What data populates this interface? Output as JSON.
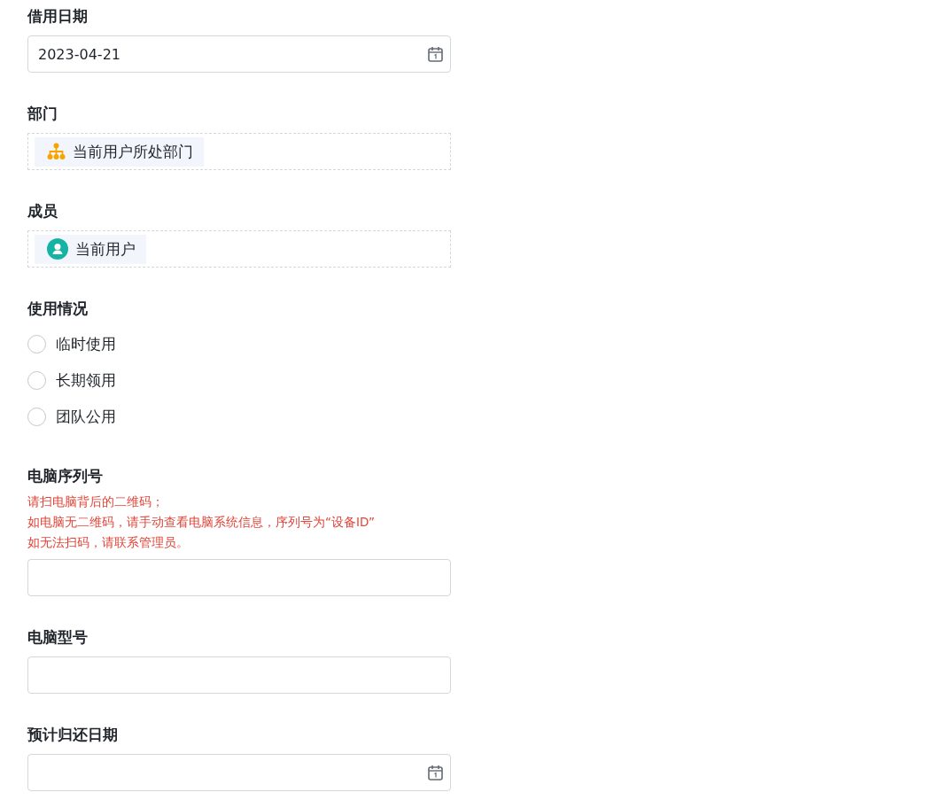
{
  "fields": [
    {
      "kind": "date",
      "label": "借用日期",
      "value": "2023-04-21"
    },
    {
      "kind": "department",
      "label": "部门",
      "tags": [
        "当前用户所处部门"
      ]
    },
    {
      "kind": "member",
      "label": "成员",
      "tags": [
        "当前用户"
      ]
    },
    {
      "kind": "radio",
      "label": "使用情况",
      "options": [
        {
          "label": "临时使用",
          "selected": false
        },
        {
          "label": "长期领用",
          "selected": false
        },
        {
          "label": "团队公用",
          "selected": false
        }
      ]
    },
    {
      "kind": "text",
      "label": "电脑序列号",
      "hint": [
        "请扫电脑背后的二维码；",
        "如电脑无二维码，请手动查看电脑系统信息，序列号为“设备ID”",
        "如无法扫码，请联系管理员。"
      ]
    },
    {
      "kind": "text",
      "label": "电脑型号"
    },
    {
      "kind": "date",
      "label": "预计归还日期"
    }
  ]
}
